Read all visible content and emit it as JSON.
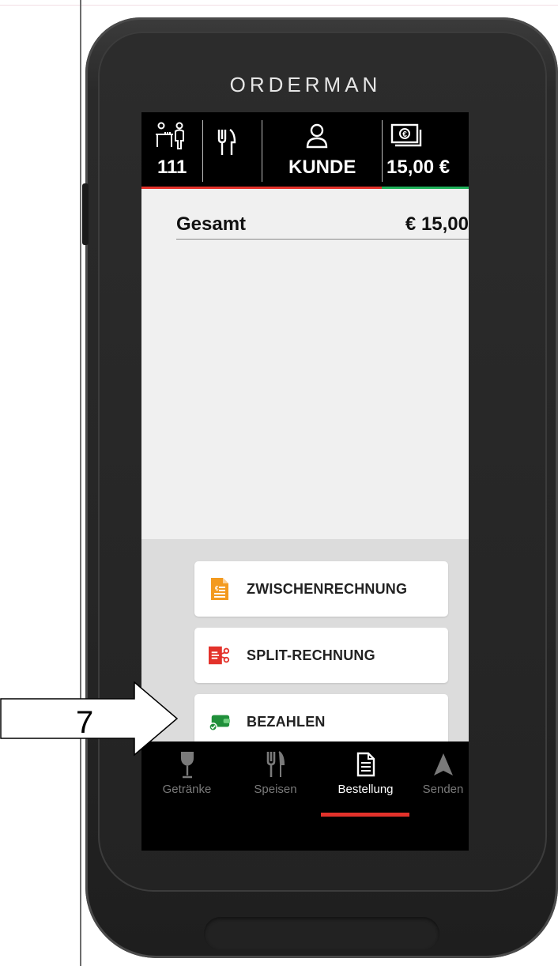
{
  "device": {
    "brand": "ORDERMAN"
  },
  "header": {
    "table_number": "111",
    "customer_label": "KUNDE",
    "amount": "15,00 €"
  },
  "order": {
    "total_label": "Gesamt",
    "total_value": "€ 15,00"
  },
  "actions": [
    {
      "label": "ZWISCHENRECHNUNG",
      "icon": "interim-invoice-icon"
    },
    {
      "label": "SPLIT-RECHNUNG",
      "icon": "split-invoice-icon"
    },
    {
      "label": "BEZAHLEN",
      "icon": "wallet-icon"
    }
  ],
  "nav": [
    {
      "label": "Getränke",
      "icon": "wine-glass-icon",
      "active": false
    },
    {
      "label": "Speisen",
      "icon": "fork-knife-icon",
      "active": false
    },
    {
      "label": "Bestellung",
      "icon": "document-icon",
      "active": true
    },
    {
      "label": "Senden",
      "icon": "send-arrow-icon",
      "active": false
    }
  ],
  "annotation": {
    "number": "7"
  },
  "colors": {
    "red": "#e3322b",
    "green": "#1fb15a",
    "orange": "#f39a1f",
    "header_bg": "#000000"
  }
}
